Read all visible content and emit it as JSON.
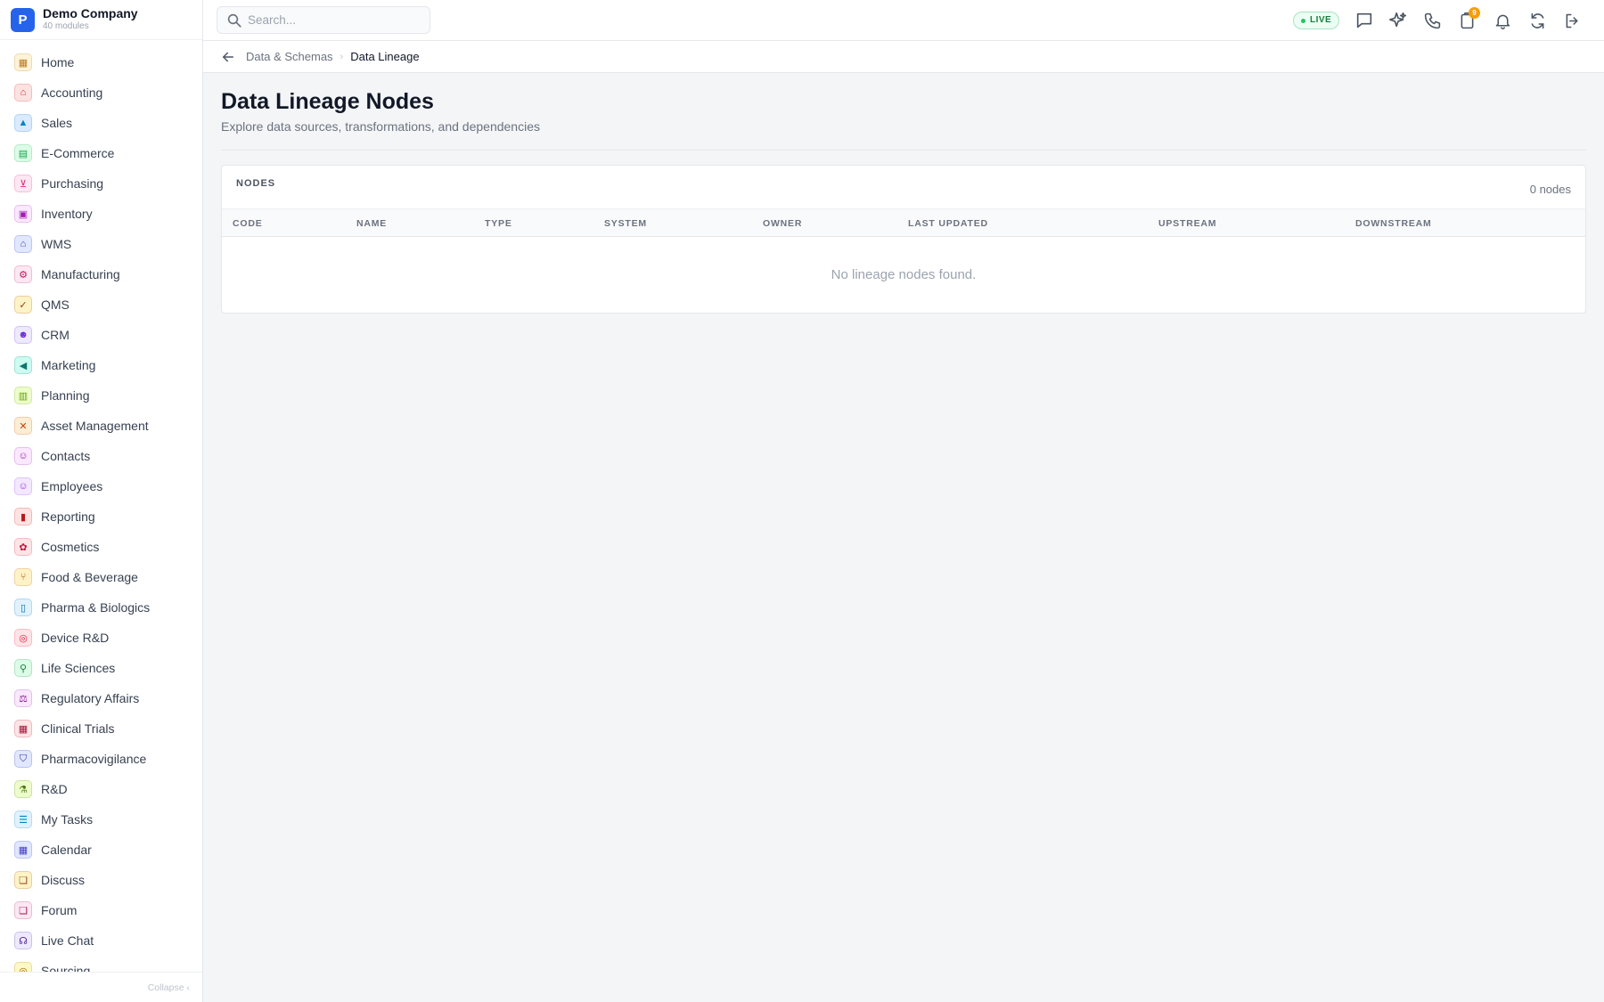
{
  "company": {
    "logo_letter": "P",
    "name": "Demo Company",
    "modules": "40 modules"
  },
  "search": {
    "placeholder": "Search..."
  },
  "status": {
    "live": "LIVE"
  },
  "notifications": {
    "badge": "9"
  },
  "sidebar": {
    "items": [
      {
        "label": "Home",
        "icon": "grid-icon",
        "glyph": "▦",
        "bg": "#fdf3d8",
        "fg": "#b7791f"
      },
      {
        "label": "Accounting",
        "icon": "bank-icon",
        "glyph": "⌂",
        "bg": "#fde2e2",
        "fg": "#dc2626"
      },
      {
        "label": "Sales",
        "icon": "tag-icon",
        "glyph": "▲",
        "bg": "#dbeafe",
        "fg": "#0284c7"
      },
      {
        "label": "E-Commerce",
        "icon": "store-icon",
        "glyph": "▤",
        "bg": "#dcfce7",
        "fg": "#16a34a"
      },
      {
        "label": "Purchasing",
        "icon": "cart-icon",
        "glyph": "⊻",
        "bg": "#fce7f3",
        "fg": "#db2777"
      },
      {
        "label": "Inventory",
        "icon": "box-icon",
        "glyph": "▣",
        "bg": "#fae8ff",
        "fg": "#a21caf"
      },
      {
        "label": "WMS",
        "icon": "warehouse-icon",
        "glyph": "⌂",
        "bg": "#e0e7ff",
        "fg": "#4338ca"
      },
      {
        "label": "Manufacturing",
        "icon": "factory-icon",
        "glyph": "⚙",
        "bg": "#fce7f3",
        "fg": "#be185d"
      },
      {
        "label": "QMS",
        "icon": "check-badge-icon",
        "glyph": "✓",
        "bg": "#fef3c7",
        "fg": "#92400e"
      },
      {
        "label": "CRM",
        "icon": "users-icon",
        "glyph": "☻",
        "bg": "#ede9fe",
        "fg": "#6d28d9"
      },
      {
        "label": "Marketing",
        "icon": "megaphone-icon",
        "glyph": "◀",
        "bg": "#ccfbf1",
        "fg": "#0f766e"
      },
      {
        "label": "Planning",
        "icon": "clipboard-icon",
        "glyph": "▥",
        "bg": "#ecfccb",
        "fg": "#65a30d"
      },
      {
        "label": "Asset Management",
        "icon": "tools-icon",
        "glyph": "✕",
        "bg": "#ffedd5",
        "fg": "#c2410c"
      },
      {
        "label": "Contacts",
        "icon": "contact-card-icon",
        "glyph": "☺",
        "bg": "#fae8ff",
        "fg": "#a21caf"
      },
      {
        "label": "Employees",
        "icon": "id-badge-icon",
        "glyph": "☺",
        "bg": "#f3e8ff",
        "fg": "#9333ea"
      },
      {
        "label": "Reporting",
        "icon": "bar-chart-icon",
        "glyph": "▮",
        "bg": "#fee2e2",
        "fg": "#b91c1c"
      },
      {
        "label": "Cosmetics",
        "icon": "flower-icon",
        "glyph": "✿",
        "bg": "#ffe4e6",
        "fg": "#be123c"
      },
      {
        "label": "Food & Beverage",
        "icon": "utensils-icon",
        "glyph": "⑂",
        "bg": "#fef3c7",
        "fg": "#b45309"
      },
      {
        "label": "Pharma & Biologics",
        "icon": "pill-bottle-icon",
        "glyph": "▯",
        "bg": "#e0f2fe",
        "fg": "#0369a1"
      },
      {
        "label": "Device R&D",
        "icon": "chip-icon",
        "glyph": "◎",
        "bg": "#ffe4e6",
        "fg": "#e11d48"
      },
      {
        "label": "Life Sciences",
        "icon": "microscope-icon",
        "glyph": "⚲",
        "bg": "#dcfce7",
        "fg": "#15803d"
      },
      {
        "label": "Regulatory Affairs",
        "icon": "gavel-icon",
        "glyph": "⚖",
        "bg": "#fae8ff",
        "fg": "#86198f"
      },
      {
        "label": "Clinical Trials",
        "icon": "clipboard-check-icon",
        "glyph": "▦",
        "bg": "#ffe4e6",
        "fg": "#9f1239"
      },
      {
        "label": "Pharmacovigilance",
        "icon": "shield-icon",
        "glyph": "⛉",
        "bg": "#e0e7ff",
        "fg": "#3730a3"
      },
      {
        "label": "R&D",
        "icon": "flask-icon",
        "glyph": "⚗",
        "bg": "#ecfccb",
        "fg": "#4d7c0f"
      },
      {
        "label": "My Tasks",
        "icon": "checklist-icon",
        "glyph": "☰",
        "bg": "#e0f2fe",
        "fg": "#0284c7"
      },
      {
        "label": "Calendar",
        "icon": "calendar-icon",
        "glyph": "▦",
        "bg": "#e0e7ff",
        "fg": "#4338ca"
      },
      {
        "label": "Discuss",
        "icon": "chat-bubbles-icon",
        "glyph": "❏",
        "bg": "#fef3c7",
        "fg": "#92400e"
      },
      {
        "label": "Forum",
        "icon": "forum-icon",
        "glyph": "❏",
        "bg": "#fce7f3",
        "fg": "#9d174d"
      },
      {
        "label": "Live Chat",
        "icon": "headset-icon",
        "glyph": "☊",
        "bg": "#ede9fe",
        "fg": "#4c1d95"
      },
      {
        "label": "Sourcing",
        "icon": "sourcing-icon",
        "glyph": "◎",
        "bg": "#fef9c3",
        "fg": "#a16207"
      }
    ],
    "collapse_label": "Collapse ‹"
  },
  "breadcrumb": {
    "parent": "Data & Schemas",
    "separator": "›",
    "current": "Data Lineage"
  },
  "page": {
    "title": "Data Lineage Nodes",
    "subtitle": "Explore data sources, transformations, and dependencies"
  },
  "nodes_table": {
    "title": "NODES",
    "count": "0 nodes",
    "columns": [
      "CODE",
      "NAME",
      "TYPE",
      "SYSTEM",
      "OWNER",
      "LAST UPDATED",
      "UPSTREAM",
      "DOWNSTREAM"
    ],
    "rows": [],
    "empty_message": "No lineage nodes found."
  },
  "colors": {
    "brand": "#2563eb",
    "live": "#22c55e",
    "badge": "#f59e0b"
  }
}
